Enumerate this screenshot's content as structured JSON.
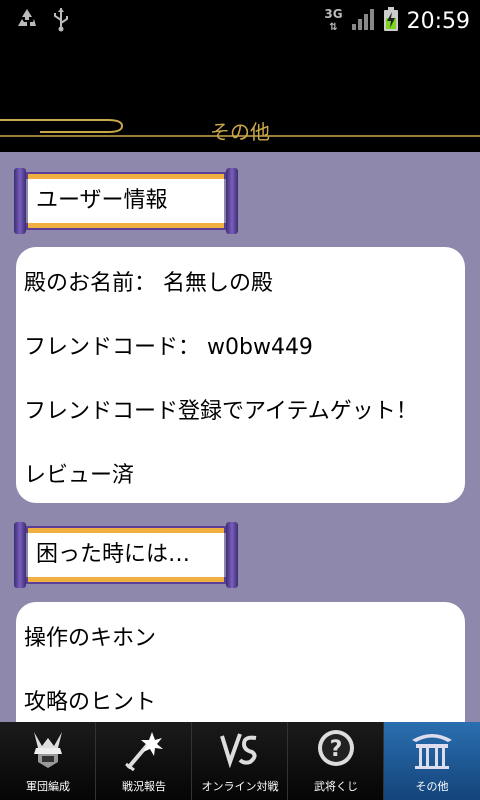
{
  "status_bar": {
    "time": "20:59",
    "network": "3G",
    "left_icons": [
      "recycle-icon",
      "usb-icon"
    ],
    "right_icons": [
      "network-3g-icon",
      "signal-icon",
      "battery-charging-icon"
    ]
  },
  "header": {
    "title": "その他"
  },
  "sections": [
    {
      "title": "ユーザー情報",
      "items": [
        "殿のお名前： 名無しの殿",
        "フレンドコード： w0bw449",
        "フレンドコード登録でアイテムゲット！",
        "レビュー済"
      ]
    },
    {
      "title": "困った時には…",
      "items": [
        "操作のキホン",
        "攻略のヒント"
      ]
    }
  ],
  "tabs": [
    {
      "label": "軍団編成",
      "icon": "samurai-helmet-icon"
    },
    {
      "label": "戦況報告",
      "icon": "sword-explosion-icon"
    },
    {
      "label": "オンライン対戦",
      "icon": "vs-icon"
    },
    {
      "label": "武将くじ",
      "icon": "question-coin-icon"
    },
    {
      "label": "その他",
      "icon": "gate-icon",
      "active": true
    }
  ],
  "colors": {
    "content_bg": "#8f88ad",
    "header_accent": "#c9a84a",
    "scroll_band": "#5a3e9a",
    "scroll_border": "#f0b040",
    "active_tab": "#2a6fb0"
  }
}
